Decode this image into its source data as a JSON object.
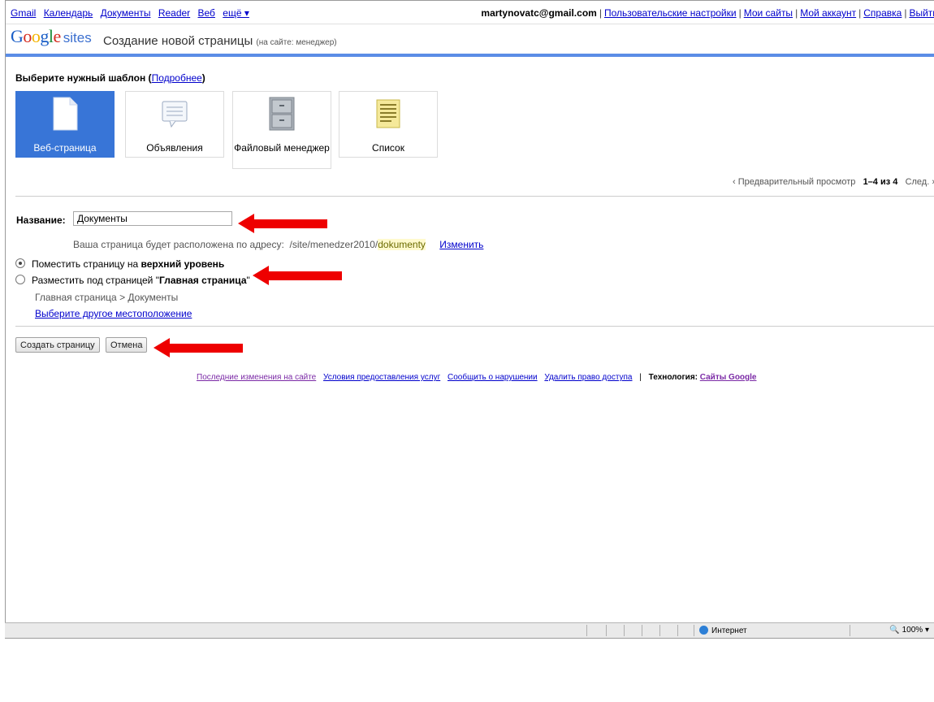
{
  "topbar": {
    "links": [
      "Gmail",
      "Календарь",
      "Документы",
      "Reader",
      "Веб",
      "ещё ▾"
    ],
    "email": "martynovatc@gmail.com",
    "right_links": [
      "Пользовательские настройки",
      "Мои сайты",
      "Мой аккаунт",
      "Справка",
      "Выйти"
    ]
  },
  "header": {
    "logo_sites": "sites",
    "title": "Создание новой страницы",
    "title_sub": "(на сайте: менеджер)"
  },
  "templates": {
    "heading": "Выберите нужный шаблон",
    "more_link": "Подробнее",
    "items": [
      {
        "label": "Веб-страница",
        "icon": "web-page-icon",
        "selected": true
      },
      {
        "label": "Объявления",
        "icon": "announcements-icon",
        "selected": false
      },
      {
        "label": "Файловый менеджер",
        "icon": "file-cabinet-icon",
        "selected": false
      },
      {
        "label": "Список",
        "icon": "list-icon",
        "selected": false
      }
    ]
  },
  "preview": {
    "label": "‹ Предварительный просмотр",
    "range": "1–4 из 4",
    "next": "След. ›"
  },
  "form": {
    "name_label": "Название:",
    "name_value": "Документы",
    "url_prefix": "Ваша страница будет расположена по адресу:",
    "url_path": "/site/menedzer2010/",
    "url_slug": "dokumenty",
    "change_link": "Изменить",
    "option_top_prefix": "Поместить страницу на ",
    "option_top_bold": "верхний уровень",
    "option_under_prefix": "Разместить под страницей \"",
    "option_under_bold": "Главная страница",
    "option_under_suffix": "\"",
    "breadcrumb": "Главная страница > Документы",
    "other_location": "Выберите другое местоположение"
  },
  "buttons": {
    "create": "Создать страницу",
    "cancel": "Отмена"
  },
  "footer": {
    "links": [
      "Последние изменения на сайте",
      "Условия предоставления услуг",
      "Сообщить о нарушении",
      "Удалить право доступа"
    ],
    "separator": "|",
    "tech_label": "Технология:",
    "tech_link": "Сайты Google"
  },
  "statusbar": {
    "zone": "Интернет",
    "zoom": "100%"
  },
  "colors": {
    "accent_blue": "#3875d7",
    "header_rule": "#5b8de6",
    "arrow_red": "#ee0000",
    "link": "#0000cc"
  }
}
